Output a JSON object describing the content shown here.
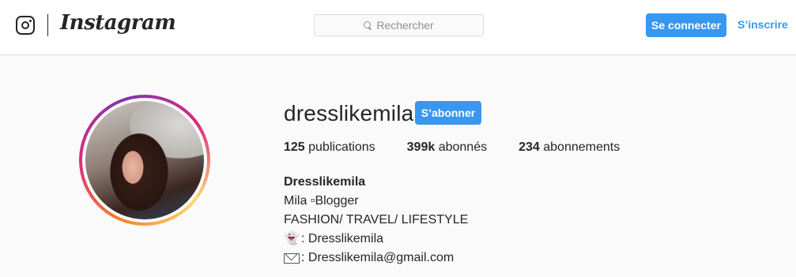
{
  "header": {
    "brand": "Instagram",
    "search_placeholder": "Rechercher",
    "login_label": "Se connecter",
    "signup_label": "S’inscrire",
    "accent_color": "#3897f0"
  },
  "profile": {
    "username": "dresslikemila",
    "follow_label": "S’abonner",
    "stats": {
      "posts_count": "125",
      "posts_label": "publications",
      "followers_count": "399k",
      "followers_label": "abonnés",
      "following_count": "234",
      "following_label": "abonnements"
    },
    "bio": {
      "full_name": "Dresslikemila",
      "line1": "Mila ▫Blogger",
      "line2": "FASHION/ TRAVEL/ LIFESTYLE",
      "snapchat_icon": "👻",
      "snapchat_text": ": Dresslikemila",
      "email_icon": "envelope-icon",
      "email_text": ": Dresslikemila@gmail.com"
    }
  }
}
